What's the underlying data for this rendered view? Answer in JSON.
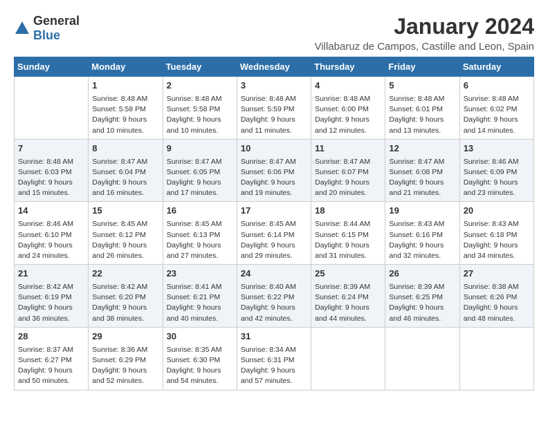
{
  "logo": {
    "general": "General",
    "blue": "Blue"
  },
  "title": "January 2024",
  "subtitle": "Villabaruz de Campos, Castille and Leon, Spain",
  "days_of_week": [
    "Sunday",
    "Monday",
    "Tuesday",
    "Wednesday",
    "Thursday",
    "Friday",
    "Saturday"
  ],
  "weeks": [
    [
      {
        "day": "",
        "content": ""
      },
      {
        "day": "1",
        "content": "Sunrise: 8:48 AM\nSunset: 5:58 PM\nDaylight: 9 hours\nand 10 minutes."
      },
      {
        "day": "2",
        "content": "Sunrise: 8:48 AM\nSunset: 5:58 PM\nDaylight: 9 hours\nand 10 minutes."
      },
      {
        "day": "3",
        "content": "Sunrise: 8:48 AM\nSunset: 5:59 PM\nDaylight: 9 hours\nand 11 minutes."
      },
      {
        "day": "4",
        "content": "Sunrise: 8:48 AM\nSunset: 6:00 PM\nDaylight: 9 hours\nand 12 minutes."
      },
      {
        "day": "5",
        "content": "Sunrise: 8:48 AM\nSunset: 6:01 PM\nDaylight: 9 hours\nand 13 minutes."
      },
      {
        "day": "6",
        "content": "Sunrise: 8:48 AM\nSunset: 6:02 PM\nDaylight: 9 hours\nand 14 minutes."
      }
    ],
    [
      {
        "day": "7",
        "content": "Sunrise: 8:48 AM\nSunset: 6:03 PM\nDaylight: 9 hours\nand 15 minutes."
      },
      {
        "day": "8",
        "content": "Sunrise: 8:47 AM\nSunset: 6:04 PM\nDaylight: 9 hours\nand 16 minutes."
      },
      {
        "day": "9",
        "content": "Sunrise: 8:47 AM\nSunset: 6:05 PM\nDaylight: 9 hours\nand 17 minutes."
      },
      {
        "day": "10",
        "content": "Sunrise: 8:47 AM\nSunset: 6:06 PM\nDaylight: 9 hours\nand 19 minutes."
      },
      {
        "day": "11",
        "content": "Sunrise: 8:47 AM\nSunset: 6:07 PM\nDaylight: 9 hours\nand 20 minutes."
      },
      {
        "day": "12",
        "content": "Sunrise: 8:47 AM\nSunset: 6:08 PM\nDaylight: 9 hours\nand 21 minutes."
      },
      {
        "day": "13",
        "content": "Sunrise: 8:46 AM\nSunset: 6:09 PM\nDaylight: 9 hours\nand 23 minutes."
      }
    ],
    [
      {
        "day": "14",
        "content": "Sunrise: 8:46 AM\nSunset: 6:10 PM\nDaylight: 9 hours\nand 24 minutes."
      },
      {
        "day": "15",
        "content": "Sunrise: 8:45 AM\nSunset: 6:12 PM\nDaylight: 9 hours\nand 26 minutes."
      },
      {
        "day": "16",
        "content": "Sunrise: 8:45 AM\nSunset: 6:13 PM\nDaylight: 9 hours\nand 27 minutes."
      },
      {
        "day": "17",
        "content": "Sunrise: 8:45 AM\nSunset: 6:14 PM\nDaylight: 9 hours\nand 29 minutes."
      },
      {
        "day": "18",
        "content": "Sunrise: 8:44 AM\nSunset: 6:15 PM\nDaylight: 9 hours\nand 31 minutes."
      },
      {
        "day": "19",
        "content": "Sunrise: 8:43 AM\nSunset: 6:16 PM\nDaylight: 9 hours\nand 32 minutes."
      },
      {
        "day": "20",
        "content": "Sunrise: 8:43 AM\nSunset: 6:18 PM\nDaylight: 9 hours\nand 34 minutes."
      }
    ],
    [
      {
        "day": "21",
        "content": "Sunrise: 8:42 AM\nSunset: 6:19 PM\nDaylight: 9 hours\nand 36 minutes."
      },
      {
        "day": "22",
        "content": "Sunrise: 8:42 AM\nSunset: 6:20 PM\nDaylight: 9 hours\nand 38 minutes."
      },
      {
        "day": "23",
        "content": "Sunrise: 8:41 AM\nSunset: 6:21 PM\nDaylight: 9 hours\nand 40 minutes."
      },
      {
        "day": "24",
        "content": "Sunrise: 8:40 AM\nSunset: 6:22 PM\nDaylight: 9 hours\nand 42 minutes."
      },
      {
        "day": "25",
        "content": "Sunrise: 8:39 AM\nSunset: 6:24 PM\nDaylight: 9 hours\nand 44 minutes."
      },
      {
        "day": "26",
        "content": "Sunrise: 8:39 AM\nSunset: 6:25 PM\nDaylight: 9 hours\nand 46 minutes."
      },
      {
        "day": "27",
        "content": "Sunrise: 8:38 AM\nSunset: 6:26 PM\nDaylight: 9 hours\nand 48 minutes."
      }
    ],
    [
      {
        "day": "28",
        "content": "Sunrise: 8:37 AM\nSunset: 6:27 PM\nDaylight: 9 hours\nand 50 minutes."
      },
      {
        "day": "29",
        "content": "Sunrise: 8:36 AM\nSunset: 6:29 PM\nDaylight: 9 hours\nand 52 minutes."
      },
      {
        "day": "30",
        "content": "Sunrise: 8:35 AM\nSunset: 6:30 PM\nDaylight: 9 hours\nand 54 minutes."
      },
      {
        "day": "31",
        "content": "Sunrise: 8:34 AM\nSunset: 6:31 PM\nDaylight: 9 hours\nand 57 minutes."
      },
      {
        "day": "",
        "content": ""
      },
      {
        "day": "",
        "content": ""
      },
      {
        "day": "",
        "content": ""
      }
    ]
  ]
}
